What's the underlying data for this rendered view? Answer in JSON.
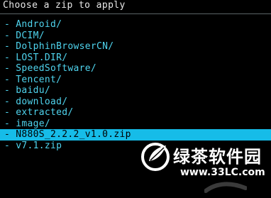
{
  "header": {
    "title": "Choose a zip to apply"
  },
  "file_list": {
    "items": [
      {
        "label": "- Android/",
        "selected": false
      },
      {
        "label": "- DCIM/",
        "selected": false
      },
      {
        "label": "- DolphinBrowserCN/",
        "selected": false
      },
      {
        "label": "- LOST.DIR/",
        "selected": false
      },
      {
        "label": "- SpeedSoftware/",
        "selected": false
      },
      {
        "label": "- Tencent/",
        "selected": false
      },
      {
        "label": "- baidu/",
        "selected": false
      },
      {
        "label": "- download/",
        "selected": false
      },
      {
        "label": "- extracted/",
        "selected": false
      },
      {
        "label": "- image/",
        "selected": false
      },
      {
        "label": "- N880S_2.2.2_v1.0.zip",
        "selected": true
      },
      {
        "label": "- v7.1.zip",
        "selected": false
      }
    ]
  },
  "watermark": {
    "brand": "绿茶软件园",
    "url": "www.33LC.com",
    "logo_icon": "green-tea-leaf-logo-icon"
  },
  "colors": {
    "background": "#000000",
    "item_text": "#4fd4ee",
    "selection_bg": "#16bce8",
    "header_text": "#e8e8e8"
  }
}
